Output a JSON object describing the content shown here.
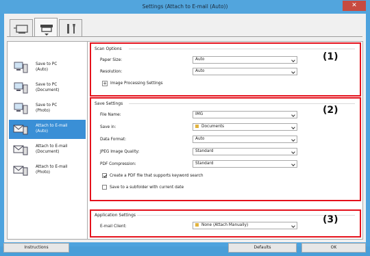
{
  "window": {
    "title": "Settings (Attach to E-mail (Auto))"
  },
  "tabs": [
    {
      "name": "scan-from-computer",
      "icon": "computer-scan-icon"
    },
    {
      "name": "scan-from-panel",
      "icon": "scanner-icon"
    },
    {
      "name": "general-settings",
      "icon": "tools-icon"
    }
  ],
  "nav": [
    {
      "line1": "Save to PC",
      "line2": "(Auto)",
      "icon": "pc-icon"
    },
    {
      "line1": "Save to PC",
      "line2": "(Document)",
      "icon": "pc-icon"
    },
    {
      "line1": "Save to PC",
      "line2": "(Photo)",
      "icon": "pc-icon"
    },
    {
      "line1": "Attach to E-mail",
      "line2": "(Auto)",
      "icon": "mail-icon"
    },
    {
      "line1": "Attach to E-mail",
      "line2": "(Document)",
      "icon": "mail-icon"
    },
    {
      "line1": "Attach to E-mail",
      "line2": "(Photo)",
      "icon": "mail-icon"
    }
  ],
  "scan_options": {
    "title": "Scan Options",
    "marker": "(1)",
    "paper_size_label": "Paper Size:",
    "paper_size_value": "Auto",
    "resolution_label": "Resolution:",
    "resolution_value": "Auto",
    "image_processing_label": "Image Processing Settings",
    "plus": "+"
  },
  "save_settings": {
    "title": "Save Settings",
    "marker": "(2)",
    "file_name_label": "File Name:",
    "file_name_value": "IMG",
    "save_in_label": "Save in:",
    "save_in_value": "Documents",
    "data_format_label": "Data Format:",
    "data_format_value": "Auto",
    "jpeg_quality_label": "JPEG Image Quality:",
    "jpeg_quality_value": "Standard",
    "pdf_compression_label": "PDF Compression:",
    "pdf_compression_value": "Standard",
    "keyword_search_label": "Create a PDF file that supports keyword search",
    "keyword_search_checked": true,
    "subfolder_label": "Save to a subfolder with current date",
    "subfolder_checked": false
  },
  "application_settings": {
    "title": "Application Settings",
    "marker": "(3)",
    "email_client_label": "E-mail Client:",
    "email_client_value": "None (Attach Manually)"
  },
  "buttons": {
    "instructions": "Instructions",
    "defaults": "Defaults",
    "ok": "OK"
  },
  "colors": {
    "highlight_border": "#e4111b",
    "selection": "#3a8fd6",
    "frame": "#4ea3de"
  }
}
